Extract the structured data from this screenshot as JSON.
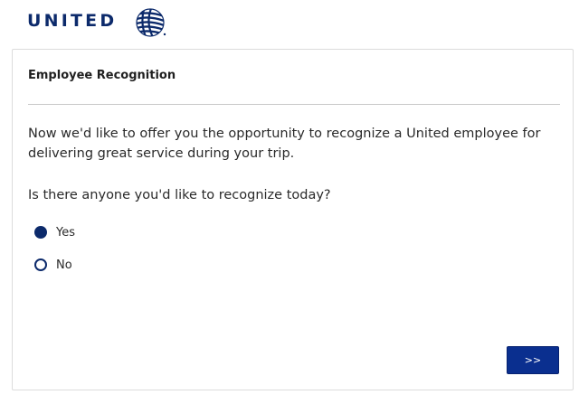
{
  "brand": {
    "logo_text": "UNITED",
    "logo_icon": "united-globe-icon",
    "color": "#0c2a6b"
  },
  "card": {
    "title": "Employee Recognition",
    "intro": "Now we'd like to offer you the opportunity to recognize a United employee for delivering great service during your trip.",
    "question": "Is there anyone you'd like to recognize today?",
    "options": [
      {
        "label": "Yes",
        "selected": true
      },
      {
        "label": "No",
        "selected": false
      }
    ],
    "next_label": ">>",
    "button_color": "#0a2f8f"
  }
}
